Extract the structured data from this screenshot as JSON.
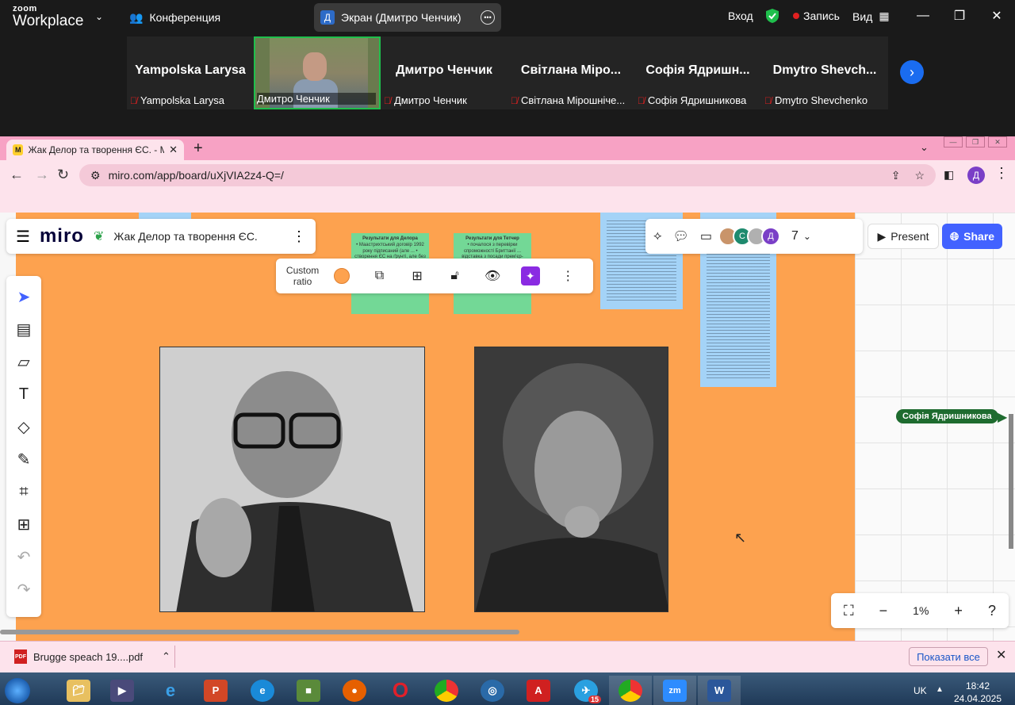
{
  "zoom": {
    "logo_line1": "zoom",
    "logo_line2": "Workplace",
    "conference_label": "Конференция",
    "screen_share_label": "Экран (Дмитро Ченчик)",
    "screen_share_avatar": "Д",
    "login_label": "Вход",
    "record_label": "Запись",
    "view_label": "Вид",
    "participants": [
      {
        "name": "Yampolska Larysa",
        "footer": "Yampolska Larysa",
        "muted": true,
        "video": false
      },
      {
        "name": "",
        "footer": "Дмитро Ченчик",
        "muted": false,
        "video": true
      },
      {
        "name": "Дмитро Ченчик",
        "footer": "Дмитро Ченчик",
        "muted": true,
        "video": false
      },
      {
        "name": "Світлана Міро...",
        "footer": "Світлана Мірошніче...",
        "muted": true,
        "video": false
      },
      {
        "name": "Софія Ядришн...",
        "footer": "Софія Ядришникова",
        "muted": true,
        "video": false
      },
      {
        "name": "Dmytro  Shevch...",
        "footer": "Dmytro Shevchenko",
        "muted": true,
        "video": false
      }
    ]
  },
  "browser": {
    "tab_title": "Жак Делор та творення ЄС. - Mi",
    "tab_favicon": "M",
    "url": "miro.com/app/board/uXjVIA2z4-Q=/",
    "profile_initial": "Д"
  },
  "miro": {
    "logo": "miro",
    "board_name": "Жак Делор та творення ЄС.",
    "toolbar": {
      "ratio_line1": "Custom",
      "ratio_line2": "ratio"
    },
    "participants_count": "7",
    "avatars": [
      "",
      "С",
      "",
      "Д"
    ],
    "present_label": "Present",
    "share_label": "Share",
    "sticky_delors_title": "Результати для Делора",
    "sticky_delors_body": "• Маастрихтський договір 1992 року підписаний (але ... • створення ЄС на ґрунті, але без федералізації)",
    "sticky_thatcher_title": "Результати для Тетчер",
    "sticky_thatcher_body": "• почалося з перевірки спроможності Бриттанії ... відставка з посади прем'єр-міністра",
    "cursor_user": "Софія Ядришникова",
    "zoom_percent": "1%"
  },
  "downloads": {
    "file_name": "Brugge speach 19....pdf",
    "show_all": "Показати все"
  },
  "taskbar": {
    "language": "UK",
    "time": "18:42",
    "date": "24.04.2025",
    "telegram_badge": "15"
  },
  "colors": {
    "frame": "#fda24f",
    "miro_share": "#4262ff",
    "browser_pink": "#f7a2c4",
    "zoom_active": "#1fbf4c"
  }
}
